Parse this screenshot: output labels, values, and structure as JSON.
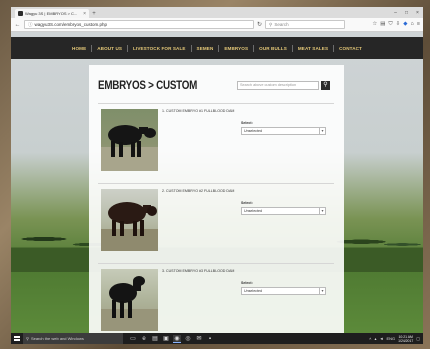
{
  "browser": {
    "tab_title": "Wagyu 3S | EMBRYOS > C...",
    "tab_close": "×",
    "new_tab": "+",
    "url": "wagyu3S.com/embryos_custom.php",
    "search_placeholder": "Search",
    "window_controls": [
      "–",
      "□",
      "×"
    ]
  },
  "site": {
    "menu": [
      "HOME",
      "ABOUT US",
      "LIVESTOCK FOR SALE",
      "SEMEN",
      "EMBRYOS",
      "OUR BULLS",
      "MEAT SALES",
      "CONTACT"
    ],
    "page_title": "EMBRYOS > CUSTOM",
    "search_placeholder": "Search above custom description",
    "items": [
      {
        "label": "1. CUSTOM EMBRYO #1 FULLBLOOD DAM",
        "select_label": "Select:",
        "selected": "Unselected"
      },
      {
        "label": "2. CUSTOM EMBRYO #2 FULLBLOOD DAM",
        "select_label": "Select:",
        "selected": "Unselected"
      },
      {
        "label": "3. CUSTOM EMBRYO #3 FULLBLOOD DAM",
        "select_label": "Select:",
        "selected": "Unselected"
      }
    ]
  },
  "taskbar": {
    "search_text": "Search the web and Windows",
    "lang": "ENG",
    "time": "10:21 AM",
    "date": "1/24/2017"
  },
  "colors": {
    "menu_text": "#e4c878",
    "menu_bg": "#262626"
  }
}
